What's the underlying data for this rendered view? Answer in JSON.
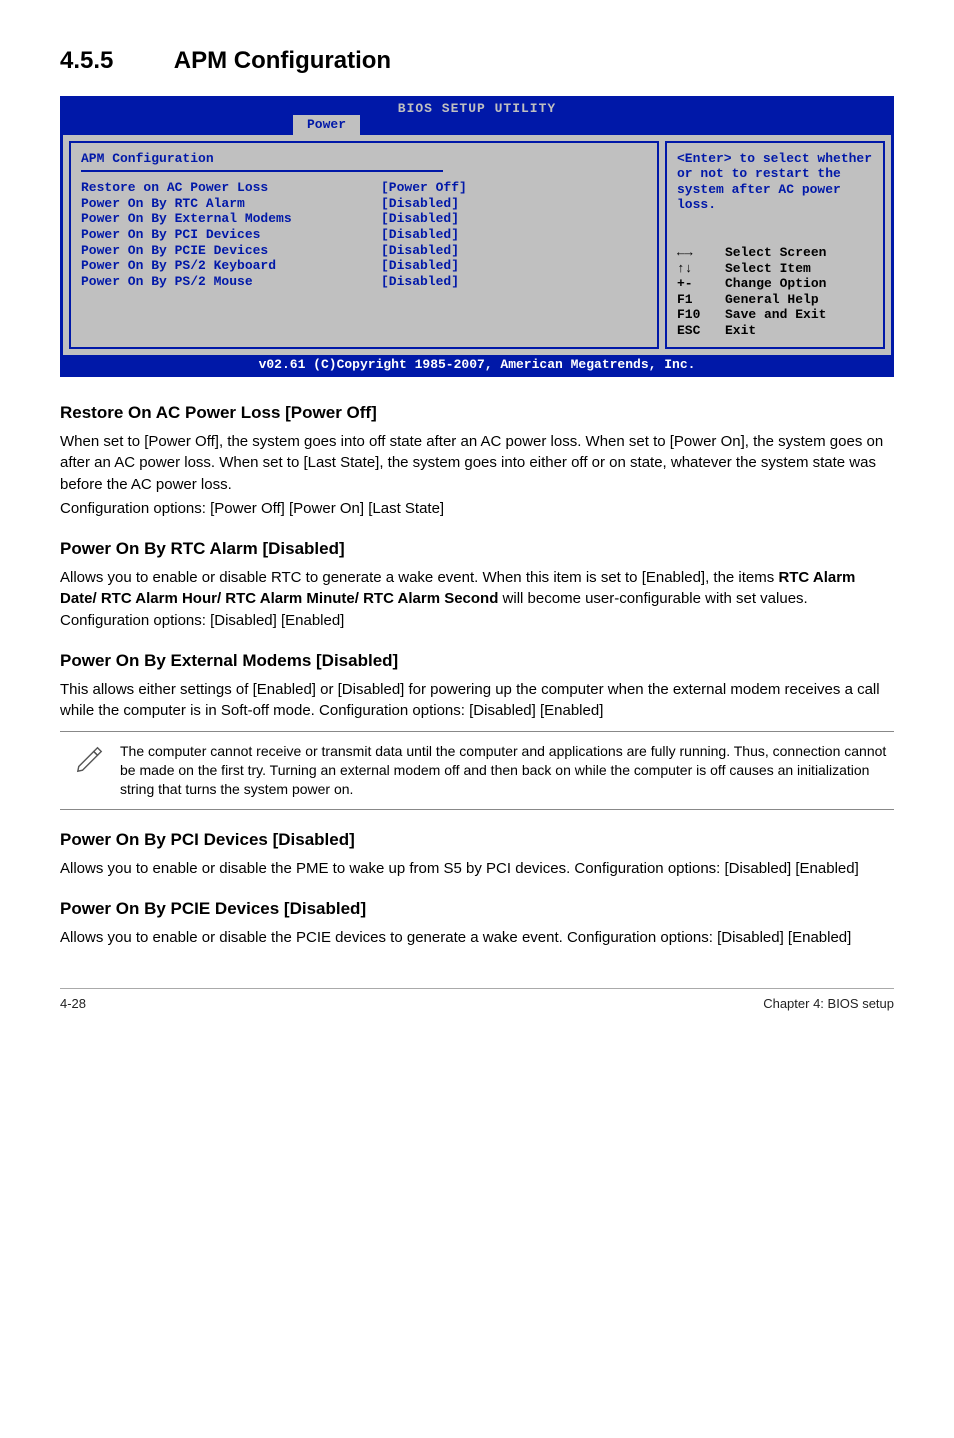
{
  "heading": {
    "number": "4.5.5",
    "title": "APM Configuration"
  },
  "bios": {
    "window_title": "BIOS SETUP UTILITY",
    "tab": "Power",
    "section_title": "APM Configuration",
    "items": [
      {
        "label": "Restore on AC Power Loss",
        "value": "[Power Off]"
      },
      {
        "label": "Power On By RTC Alarm",
        "value": "[Disabled]"
      },
      {
        "label": "Power On By External Modems",
        "value": "[Disabled]"
      },
      {
        "label": "Power On By PCI Devices",
        "value": "[Disabled]"
      },
      {
        "label": "Power On By PCIE Devices",
        "value": "[Disabled]"
      },
      {
        "label": "Power On By PS/2 Keyboard",
        "value": "[Disabled]"
      },
      {
        "label": "Power On By PS/2 Mouse",
        "value": "[Disabled]"
      }
    ],
    "help_text": "<Enter> to select whether or not to restart the system after AC power loss.",
    "keys": [
      {
        "key": "←→",
        "desc": "Select Screen"
      },
      {
        "key": "↑↓",
        "desc": "Select Item"
      },
      {
        "key": "+-",
        "desc": "Change Option"
      },
      {
        "key": "F1",
        "desc": "General Help"
      },
      {
        "key": "F10",
        "desc": "Save and Exit"
      },
      {
        "key": "ESC",
        "desc": "Exit"
      }
    ],
    "footer": "v02.61 (C)Copyright 1985-2007, American Megatrends, Inc."
  },
  "sections": {
    "s1": {
      "title": "Restore On AC Power Loss [Power Off]",
      "p1": "When set to [Power Off], the system goes into off state after an AC power loss. When set to [Power On], the system goes on after an AC power loss. When set to [Last State], the system goes into either off or on state, whatever the system state was before the AC power loss.",
      "p2": "Configuration options: [Power Off] [Power On] [Last State]"
    },
    "s2": {
      "title": "Power On By RTC Alarm [Disabled]",
      "p1_pre": "Allows you to enable or disable RTC to generate a wake event. When this item is set to [Enabled], the items ",
      "p1_bold": "RTC Alarm Date/ RTC Alarm Hour/ RTC Alarm Minute/ RTC Alarm Second",
      "p1_post": " will become user-configurable with set values. Configuration options: [Disabled] [Enabled]"
    },
    "s3": {
      "title": "Power On By External Modems [Disabled]",
      "p1": "This allows either settings of [Enabled] or [Disabled] for powering up the computer when the external modem receives a call while the computer is in Soft-off mode. Configuration options: [Disabled] [Enabled]"
    },
    "note": "The computer cannot receive or transmit data until the computer and applications are fully running. Thus, connection cannot be made on the first try. Turning an external modem off and then back on while the computer is off causes an initialization string that turns the system power on.",
    "s4": {
      "title": "Power On By PCI Devices [Disabled]",
      "p1": "Allows you to enable or disable the PME to wake up from S5 by PCI devices. Configuration options: [Disabled] [Enabled]"
    },
    "s5": {
      "title": "Power On By PCIE Devices [Disabled]",
      "p1": "Allows you to enable or disable the PCIE devices to generate a wake event. Configuration options: [Disabled] [Enabled]"
    }
  },
  "footer": {
    "left": "4-28",
    "right": "Chapter 4: BIOS setup"
  }
}
